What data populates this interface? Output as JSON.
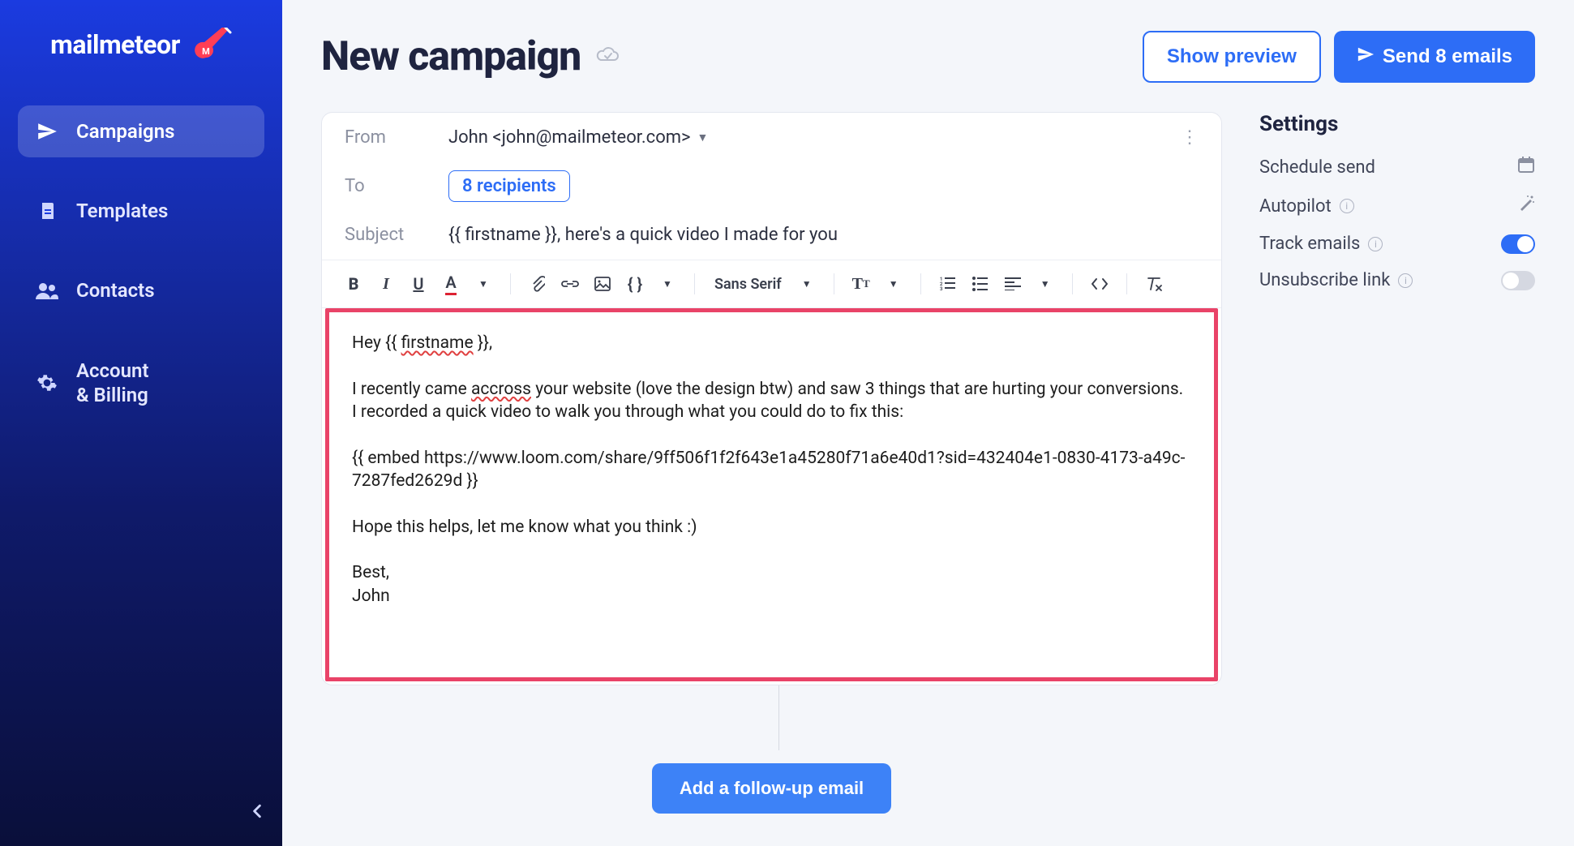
{
  "brand": {
    "name": "mailmeteor"
  },
  "sidebar": {
    "items": [
      {
        "label": "Campaigns",
        "icon": "send"
      },
      {
        "label": "Templates",
        "icon": "file"
      },
      {
        "label": "Contacts",
        "icon": "people"
      },
      {
        "label1": "Account",
        "label2": "& Billing",
        "icon": "gear"
      }
    ]
  },
  "header": {
    "title": "New campaign",
    "show_preview": "Show preview",
    "send_label": "Send 8 emails"
  },
  "compose": {
    "from_label": "From",
    "from_value": "John <john@mailmeteor.com>",
    "to_label": "To",
    "to_value": "8 recipients",
    "subject_label": "Subject",
    "subject_value": "{{ firstname }}, here's a quick video I made for you",
    "toolbar": {
      "font": "Sans Serif"
    },
    "body_line1a": "Hey {{ ",
    "body_line1_firstname": "firstname",
    "body_line1b": " }},",
    "body_line2a": "I recently came ",
    "body_line2_accross": "accross",
    "body_line2b": " your website (love the design btw) and saw 3 things that are hurting your conversions. I recorded a quick video to walk you through what you could do to fix this:",
    "body_line3": "{{ embed https://www.loom.com/share/9ff506f1f2f643e1a45280f71a6e40d1?sid=432404e1-0830-4173-a49c-7287fed2629d }}",
    "body_line4": "Hope this helps, let me know what you think :)",
    "body_line5": "Best,\nJohn"
  },
  "settings": {
    "title": "Settings",
    "schedule": "Schedule send",
    "autopilot": "Autopilot",
    "track": "Track emails",
    "unsub": "Unsubscribe link",
    "track_on": true,
    "unsub_on": false
  },
  "followup": {
    "label": "Add a follow-up email"
  }
}
